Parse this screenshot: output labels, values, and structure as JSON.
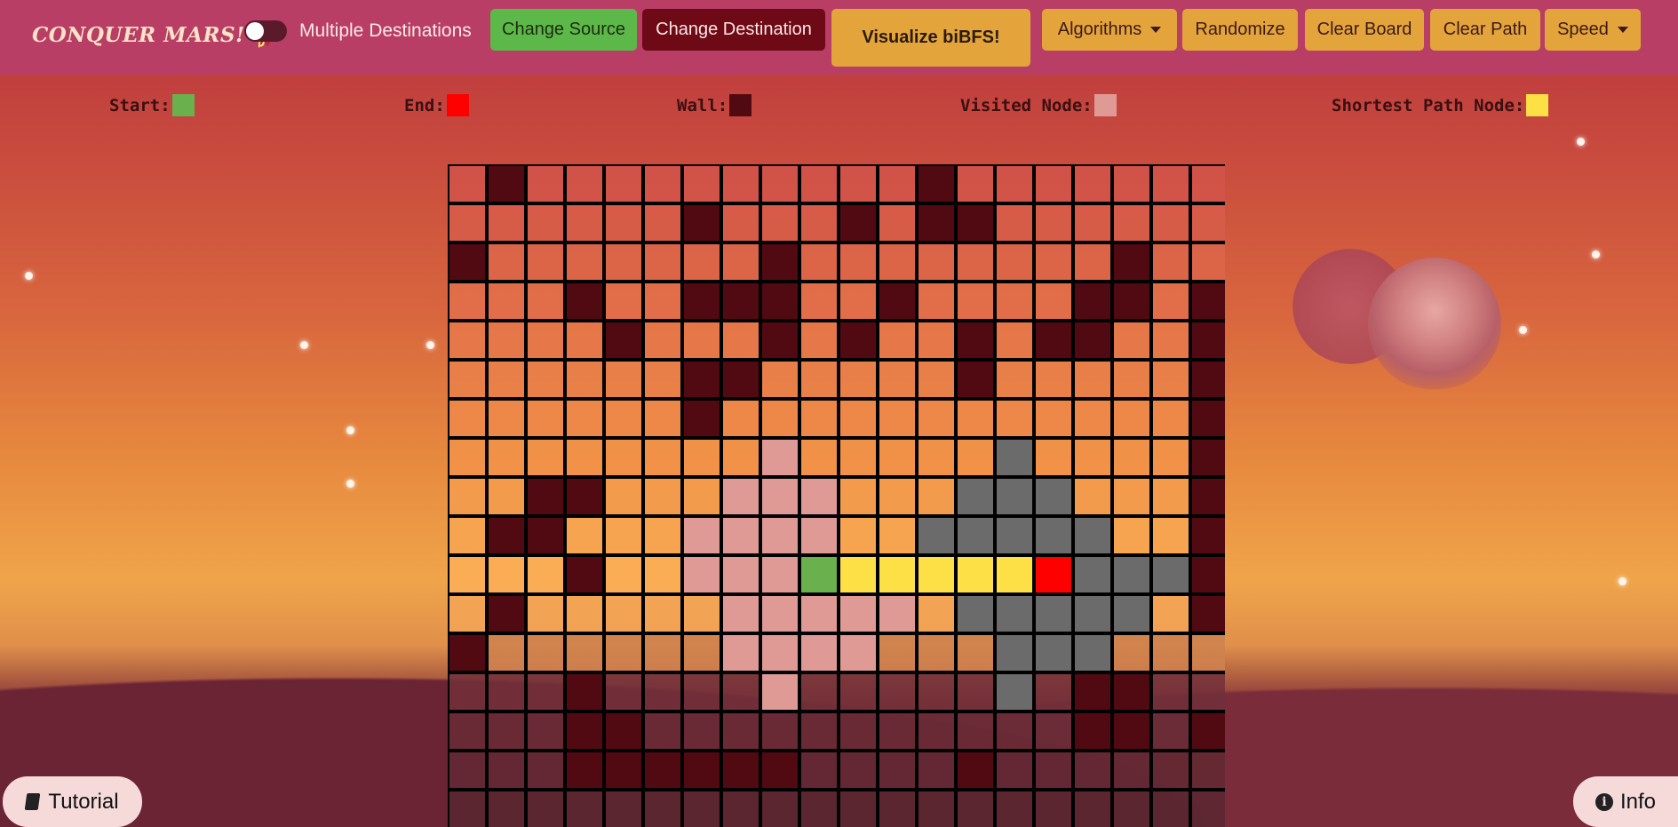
{
  "navbar": {
    "brand": "CONQUER MARS!",
    "toggle_label": "Multiple Destinations",
    "buttons": {
      "change_source": "Change Source",
      "change_destination": "Change Destination",
      "visualize": "Visualize biBFS!",
      "algorithms": "Algorithms",
      "randomize": "Randomize",
      "clear_board": "Clear Board",
      "clear_path": "Clear Path",
      "speed": "Speed"
    }
  },
  "legend": {
    "start": "Start:",
    "end": "End:",
    "wall": "Wall:",
    "visited": "Visited Node:",
    "shortest": "Shortest Path Node:"
  },
  "colors": {
    "start": "#6ab04c",
    "end": "#ff0000",
    "wall": "#520a12",
    "visited": "#e09a96",
    "visited_dest": "#6b6b6b",
    "path": "#fde046",
    "navbar": "#b83e66",
    "button": "#e4a43c"
  },
  "board": {
    "rows": 17,
    "cols": 20,
    "cells": [
      ".W..........W.......",
      "......W...W.WW......",
      "W.......W........W..",
      "...W..WWW..W....WW.W",
      "....W...W.W..W.WW..W",
      "......WW.....W.....W",
      "......W............W",
      "........V.....D....W",
      "..WW...VVV...DDD...W",
      ".WW...VVVV..DDDDD..W",
      "...W..VVVSPPPPPEDDDW",
      ".W.....VVVVV.DDDDD.W",
      "W......VVVV...DDD...",
      "...W....V.....D.WW..",
      "...WW...........WW.W",
      "...WWWWWW....W......",
      "...................."
    ]
  },
  "footer": {
    "tutorial": "Tutorial",
    "info": "Info"
  }
}
